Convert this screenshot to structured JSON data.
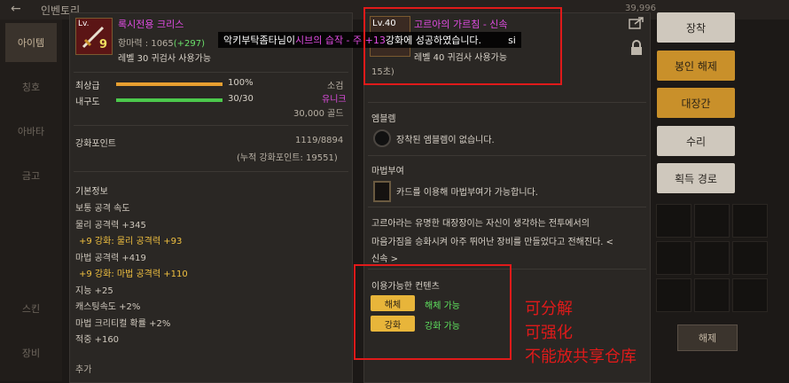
{
  "topbar": {
    "back": "←",
    "title": "인벤토리",
    "coins": "39,996"
  },
  "left_tabs": [
    "아이템",
    "칭호",
    "아바타",
    "금고",
    "스킨",
    "장비"
  ],
  "notification": {
    "prefix": "악키부탁좀타님이 ",
    "item": "시브의 습작 - 주 +13",
    "suffix": " 강화에 성공하였습니다.",
    "tail": "si"
  },
  "item": {
    "level": "Lv.",
    "enhance": "9",
    "name": "록시전용 크리스",
    "power_label": "항마력 : 1065",
    "power_bonus": "(+297)",
    "req": "레벨 30 귀검사 사용가능",
    "grade_label": "최상급",
    "grade_value": "100%",
    "grade_fraction": 1.0,
    "durability_label": "내구도",
    "durability_value": "30/30",
    "durability_fraction": 1.0,
    "bound": "소검",
    "rarity": "유니크",
    "price": "30,000 골드",
    "enh_points_label": "강화포인트",
    "enh_points_value": "1119/8894",
    "enh_points_total": "(누적 강화포인트: 19551)",
    "basic_title": "기본정보",
    "stats": [
      {
        "text": "보통 공격 속도",
        "style": "normal"
      },
      {
        "text": "물리 공격력 +345",
        "style": "normal"
      },
      {
        "text": "+9 강화: 물리 공격력 +93",
        "style": "gold"
      },
      {
        "text": "마법 공격력 +419",
        "style": "normal"
      },
      {
        "text": "+9 강화: 마법 공격력 +110",
        "style": "gold"
      },
      {
        "text": "지능 +25",
        "style": "normal"
      },
      {
        "text": "캐스팅속도 +2%",
        "style": "normal"
      },
      {
        "text": "마법 크리티컬 확률 +2%",
        "style": "normal"
      },
      {
        "text": "적중 +160",
        "style": "normal"
      }
    ],
    "more": "추가"
  },
  "compare": {
    "level": "Lv.40",
    "name": "고르아의 가르침 - 신속",
    "req": "레벨 40 귀검사 사용가능",
    "duration_tail": "15초)",
    "emblem_title": "엠블렘",
    "emblem_text": "장착된 엠블렘이 없습니다.",
    "enchant_title": "마법부여",
    "enchant_text": "카드를 이용해 마법부여가 가능합니다.",
    "desc": [
      "고르아라는 유명한 대장장이는 자신이 생각하는 전투에서의",
      "마음가짐을 승화시켜 아주 뛰어난 장비를 만들었다고 전해진다. <",
      "신속 >"
    ],
    "avail_title": "이용가능한 컨텐츠",
    "avail": [
      {
        "tag": "해체",
        "text": "해체 가능"
      },
      {
        "tag": "강화",
        "text": "강화 가능"
      }
    ]
  },
  "annotations": [
    "可分解",
    "可强化",
    "不能放共享仓库"
  ],
  "buttons": [
    {
      "label": "장착",
      "style": "gray"
    },
    {
      "label": "봉인 해제",
      "style": "gold"
    },
    {
      "label": "대장간",
      "style": "gold"
    },
    {
      "label": "수리",
      "style": "gray"
    },
    {
      "label": "획득 경로",
      "style": "gray"
    }
  ],
  "bottom_btn": "해제",
  "colors": {
    "pink": "#e04ce2",
    "gold": "#e8b53a",
    "green": "#5ee05e",
    "red_annotation": "#e01a1a"
  }
}
